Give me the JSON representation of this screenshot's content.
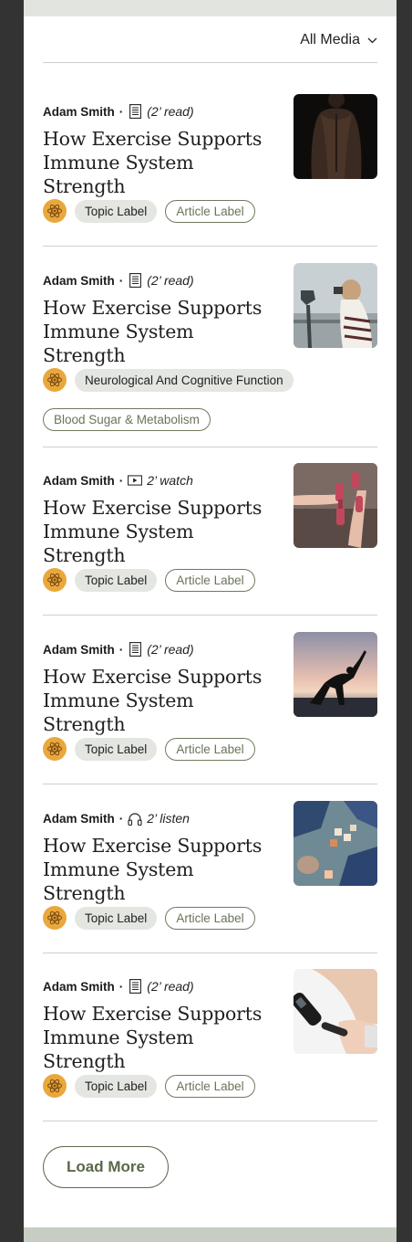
{
  "filter": {
    "label": "All Media"
  },
  "articles": [
    {
      "author": "Adam Smith",
      "separator": "·",
      "media_type": "document-icon",
      "duration": "(2’ read)",
      "title": "How Exercise Supports Immune System Strength",
      "image": "shirtless-man-back-photo",
      "tags": [
        "Topic Label"
      ],
      "article_tags": [
        "Article Label"
      ]
    },
    {
      "author": "Adam Smith",
      "separator": "·",
      "media_type": "document-icon",
      "duration": "(2’ read)",
      "title": "How Exercise Supports Immune System Strength",
      "image": "woman-binoculars-photo",
      "tags": [
        "Neurological And Cognitive Function"
      ],
      "article_tags": [
        "Blood Sugar & Metabolism"
      ]
    },
    {
      "author": "Adam Smith",
      "separator": "·",
      "media_type": "video-icon",
      "duration": "2’ watch",
      "title": "How Exercise Supports Immune System Strength",
      "image": "dumbbells-photo",
      "tags": [
        "Topic Label"
      ],
      "article_tags": [
        "Article Label"
      ]
    },
    {
      "author": "Adam Smith",
      "separator": "·",
      "media_type": "document-icon",
      "duration": "(2’ read)",
      "title": "How Exercise Supports Immune System Strength",
      "image": "yoga-silhouette-photo",
      "tags": [
        "Topic Label"
      ],
      "article_tags": [
        "Article Label"
      ]
    },
    {
      "author": "Adam Smith",
      "separator": "·",
      "media_type": "headphones-icon",
      "duration": "2’ listen",
      "title": "How Exercise Supports Immune System Strength",
      "image": "letter-blocks-photo",
      "tags": [
        "Topic Label"
      ],
      "article_tags": [
        "Article Label"
      ]
    },
    {
      "author": "Adam Smith",
      "separator": "·",
      "media_type": "document-icon",
      "duration": "(2’ read)",
      "title": "How Exercise Supports Immune System Strength",
      "image": "glucose-meter-photo",
      "tags": [
        "Topic Label"
      ],
      "article_tags": [
        "Article Label"
      ]
    }
  ],
  "load_more": {
    "label": "Load More"
  },
  "colors": {
    "topic_icon_bg": "#e9a83c",
    "accent_olive": "#5b6848",
    "chip_topic_bg": "#e4e6e1"
  }
}
